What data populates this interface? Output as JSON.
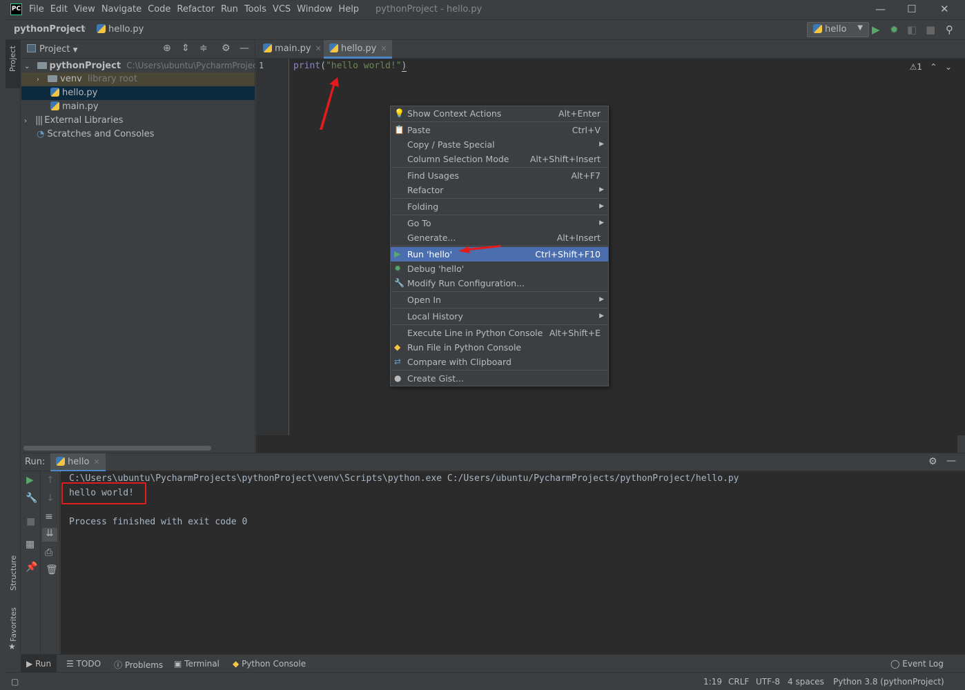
{
  "window": {
    "logo": "PC",
    "menu": [
      "File",
      "Edit",
      "View",
      "Navigate",
      "Code",
      "Refactor",
      "Run",
      "Tools",
      "VCS",
      "Window",
      "Help"
    ],
    "title": "pythonProject - hello.py"
  },
  "navbar": {
    "project": "pythonProject",
    "file": "hello.py",
    "run_config": "hello"
  },
  "left_strip": {
    "project": "Project",
    "structure": "Structure",
    "favorites": "Favorites"
  },
  "project_panel": {
    "title": "Project",
    "root_name": "pythonProject",
    "root_path": "C:\\Users\\ubuntu\\PycharmProjects\\p",
    "venv": "venv",
    "venv_note": "library root",
    "files": [
      "hello.py",
      "main.py"
    ],
    "external": "External Libraries",
    "scratches": "Scratches and Consoles"
  },
  "editor": {
    "tabs": [
      "main.py",
      "hello.py"
    ],
    "active_tab": "hello.py",
    "line_number": "1",
    "code_fn": "print",
    "code_open": "(",
    "code_str": "\"hello world!\"",
    "code_close": ")",
    "inspection": "1"
  },
  "context_menu": {
    "items": [
      {
        "label": "Show Context Actions",
        "shortcut": "Alt+Enter"
      },
      {
        "label": "Paste",
        "shortcut": "Ctrl+V"
      },
      {
        "label": "Copy / Paste Special",
        "shortcut": ""
      },
      {
        "label": "Column Selection Mode",
        "shortcut": "Alt+Shift+Insert"
      },
      {
        "label": "Find Usages",
        "shortcut": "Alt+F7"
      },
      {
        "label": "Refactor",
        "shortcut": ""
      },
      {
        "label": "Folding",
        "shortcut": ""
      },
      {
        "label": "Go To",
        "shortcut": ""
      },
      {
        "label": "Generate...",
        "shortcut": "Alt+Insert"
      },
      {
        "label": "Run 'hello'",
        "shortcut": "Ctrl+Shift+F10"
      },
      {
        "label": "Debug 'hello'",
        "shortcut": ""
      },
      {
        "label": "Modify Run Configuration...",
        "shortcut": ""
      },
      {
        "label": "Open In",
        "shortcut": ""
      },
      {
        "label": "Local History",
        "shortcut": ""
      },
      {
        "label": "Execute Line in Python Console",
        "shortcut": "Alt+Shift+E"
      },
      {
        "label": "Run File in Python Console",
        "shortcut": ""
      },
      {
        "label": "Compare with Clipboard",
        "shortcut": ""
      },
      {
        "label": "Create Gist...",
        "shortcut": ""
      }
    ],
    "selected": "Run 'hello'"
  },
  "run_panel": {
    "label": "Run:",
    "tab": "hello",
    "lines": [
      "C:\\Users\\ubuntu\\PycharmProjects\\pythonProject\\venv\\Scripts\\python.exe C:/Users/ubuntu/PycharmProjects/pythonProject/hello.py",
      "hello world!",
      "",
      "Process finished with exit code 0"
    ]
  },
  "bottom_tabs": [
    "Run",
    "TODO",
    "Problems",
    "Terminal",
    "Python Console"
  ],
  "event_log": "Event Log",
  "status": {
    "position": "1:19",
    "line_sep": "CRLF",
    "encoding": "UTF-8",
    "indent": "4 spaces",
    "interpreter": "Python 3.8 (pythonProject)"
  },
  "colors": {
    "background": "#3c3f41",
    "editor_bg": "#2b2b2b",
    "selection": "#4b6eaf",
    "annotation_red": "#e51b1b",
    "run_green": "#59a869"
  }
}
